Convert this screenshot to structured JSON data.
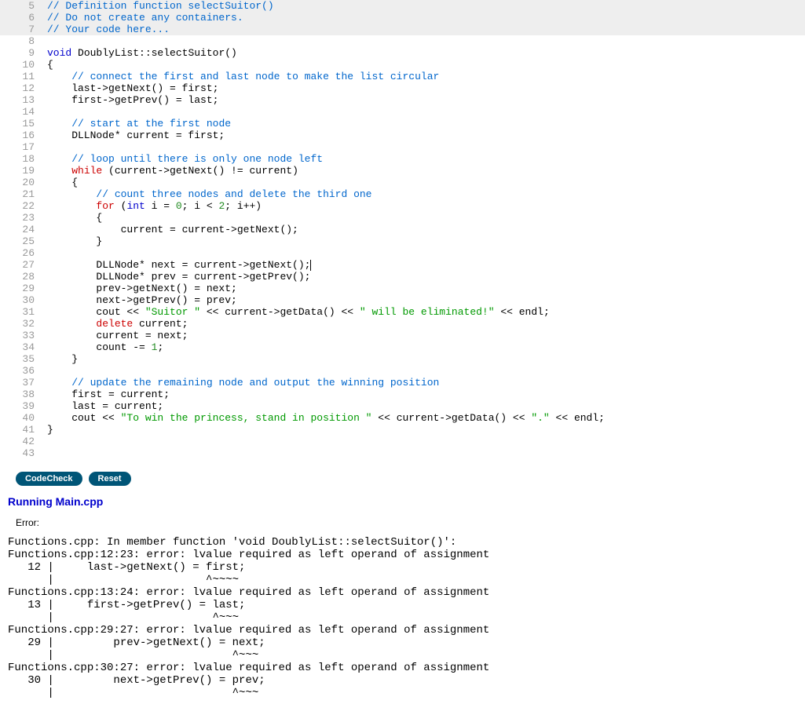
{
  "editor": {
    "lines": [
      {
        "num": 5,
        "shaded": true,
        "html": "<span class='c-comment'>// Definition function selectSuitor()</span>"
      },
      {
        "num": 6,
        "shaded": true,
        "html": "<span class='c-comment'>// Do not create any containers.</span>"
      },
      {
        "num": 7,
        "shaded": true,
        "html": "<span class='c-comment'>// Your code here...</span>"
      },
      {
        "num": 8,
        "shaded": false,
        "html": ""
      },
      {
        "num": 9,
        "shaded": false,
        "html": "<span class='c-kw'>void</span> DoublyList::selectSuitor()"
      },
      {
        "num": 10,
        "shaded": false,
        "html": "{"
      },
      {
        "num": 11,
        "shaded": false,
        "html": "    <span class='c-comment'>// connect the first and last node to make the list circular</span>"
      },
      {
        "num": 12,
        "shaded": false,
        "html": "    last-&gt;getNext() = first;"
      },
      {
        "num": 13,
        "shaded": false,
        "html": "    first-&gt;getPrev() = last;"
      },
      {
        "num": 14,
        "shaded": false,
        "html": ""
      },
      {
        "num": 15,
        "shaded": false,
        "html": "    <span class='c-comment'>// start at the first node</span>"
      },
      {
        "num": 16,
        "shaded": false,
        "html": "    DLLNode* current = first;"
      },
      {
        "num": 17,
        "shaded": false,
        "html": ""
      },
      {
        "num": 18,
        "shaded": false,
        "html": "    <span class='c-comment'>// loop until there is only one node left</span>"
      },
      {
        "num": 19,
        "shaded": false,
        "html": "    <span class='c-kw2'>while</span> (current-&gt;getNext() != current)"
      },
      {
        "num": 20,
        "shaded": false,
        "html": "    {"
      },
      {
        "num": 21,
        "shaded": false,
        "html": "        <span class='c-comment'>// count three nodes and delete the third one</span>"
      },
      {
        "num": 22,
        "shaded": false,
        "html": "        <span class='c-kw2'>for</span> (<span class='c-kw'>int</span> i = <span class='c-num'>0</span>; i &lt; <span class='c-num'>2</span>; i++)"
      },
      {
        "num": 23,
        "shaded": false,
        "html": "        {"
      },
      {
        "num": 24,
        "shaded": false,
        "html": "            current = current-&gt;getNext();"
      },
      {
        "num": 25,
        "shaded": false,
        "html": "        }"
      },
      {
        "num": 26,
        "shaded": false,
        "html": ""
      },
      {
        "num": 27,
        "shaded": false,
        "html": "        DLLNode* next = current-&gt;getNext();<span class='cursor'></span>"
      },
      {
        "num": 28,
        "shaded": false,
        "html": "        DLLNode* prev = current-&gt;getPrev();"
      },
      {
        "num": 29,
        "shaded": false,
        "html": "        prev-&gt;getNext() = next;"
      },
      {
        "num": 30,
        "shaded": false,
        "html": "        next-&gt;getPrev() = prev;"
      },
      {
        "num": 31,
        "shaded": false,
        "html": "        cout &lt;&lt; <span class='c-str'>\"Suitor \"</span> &lt;&lt; current-&gt;getData() &lt;&lt; <span class='c-str'>\" will be eliminated!\"</span> &lt;&lt; endl;"
      },
      {
        "num": 32,
        "shaded": false,
        "html": "        <span class='c-kw2'>delete</span> current;"
      },
      {
        "num": 33,
        "shaded": false,
        "html": "        current = next;"
      },
      {
        "num": 34,
        "shaded": false,
        "html": "        count -= <span class='c-num'>1</span>;"
      },
      {
        "num": 35,
        "shaded": false,
        "html": "    }"
      },
      {
        "num": 36,
        "shaded": false,
        "html": ""
      },
      {
        "num": 37,
        "shaded": false,
        "html": "    <span class='c-comment'>// update the remaining node and output the winning position</span>"
      },
      {
        "num": 38,
        "shaded": false,
        "html": "    first = current;"
      },
      {
        "num": 39,
        "shaded": false,
        "html": "    last = current;"
      },
      {
        "num": 40,
        "shaded": false,
        "html": "    cout &lt;&lt; <span class='c-str'>\"To win the princess, stand in position \"</span> &lt;&lt; current-&gt;getData() &lt;&lt; <span class='c-str'>\".\"</span> &lt;&lt; endl;"
      },
      {
        "num": 41,
        "shaded": false,
        "html": "}"
      },
      {
        "num": 42,
        "shaded": false,
        "html": ""
      },
      {
        "num": 43,
        "shaded": false,
        "html": ""
      }
    ]
  },
  "buttons": {
    "codecheck": "CodeCheck",
    "reset": "Reset"
  },
  "output": {
    "title": "Running Main.cpp",
    "label": "Error:",
    "log": "Functions.cpp: In member function 'void DoublyList::selectSuitor()':\nFunctions.cpp:12:23: error: lvalue required as left operand of assignment\n   12 |     last->getNext() = first;\n      |                       ^~~~~\nFunctions.cpp:13:24: error: lvalue required as left operand of assignment\n   13 |     first->getPrev() = last;\n      |                        ^~~~\nFunctions.cpp:29:27: error: lvalue required as left operand of assignment\n   29 |         prev->getNext() = next;\n      |                           ^~~~\nFunctions.cpp:30:27: error: lvalue required as left operand of assignment\n   30 |         next->getPrev() = prev;\n      |                           ^~~~"
  }
}
